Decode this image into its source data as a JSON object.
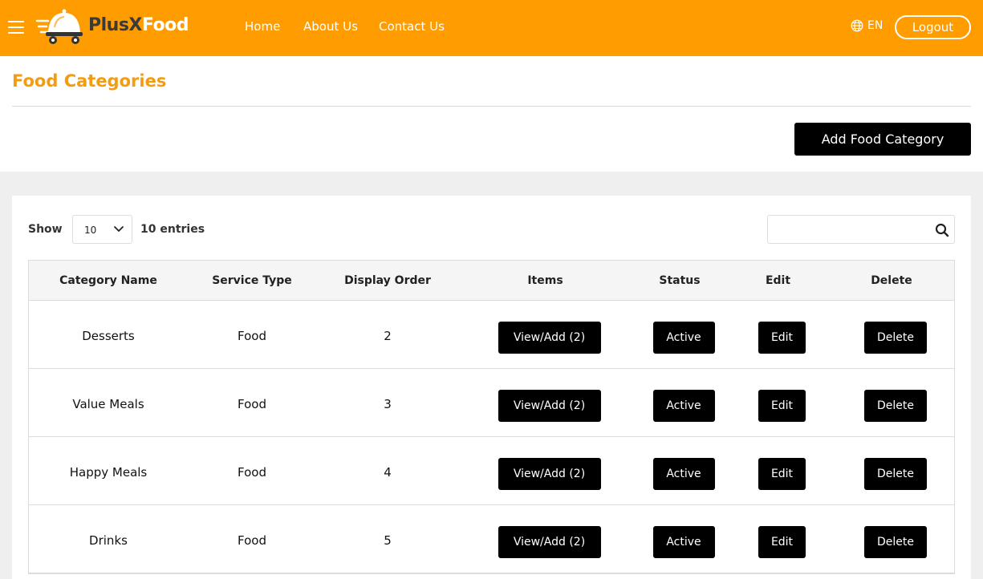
{
  "navbar": {
    "logo_plus": "PlusX",
    "logo_food": "Food",
    "links": [
      "Home",
      "About Us",
      "Contact Us"
    ],
    "language": "EN",
    "logout_label": "Logout",
    "color": "#ff9c00"
  },
  "page": {
    "title": "Food Categories",
    "add_button": "Add Food Category"
  },
  "table_controls": {
    "show_label": "Show",
    "page_size": "10",
    "entries_label": "10 entries",
    "search_value": ""
  },
  "table": {
    "columns": [
      "Category Name",
      "Service Type",
      "Display Order",
      "Items",
      "Status",
      "Edit",
      "Delete"
    ],
    "rows": [
      {
        "name": "Desserts",
        "service": "Food",
        "order": "2",
        "items": "View/Add (2)",
        "status": "Active",
        "edit": "Edit",
        "delete": "Delete"
      },
      {
        "name": "Value Meals",
        "service": "Food",
        "order": "3",
        "items": "View/Add (2)",
        "status": "Active",
        "edit": "Edit",
        "delete": "Delete"
      },
      {
        "name": "Happy Meals",
        "service": "Food",
        "order": "4",
        "items": "View/Add (2)",
        "status": "Active",
        "edit": "Edit",
        "delete": "Delete"
      },
      {
        "name": "Drinks",
        "service": "Food",
        "order": "5",
        "items": "View/Add (2)",
        "status": "Active",
        "edit": "Edit",
        "delete": "Delete"
      }
    ]
  },
  "icons": {
    "menu": "hamburger-menu-icon",
    "logo": "food-delivery-cloche-icon",
    "language": "globe-icon",
    "select": "chevron-down-icon",
    "search": "search-icon"
  }
}
